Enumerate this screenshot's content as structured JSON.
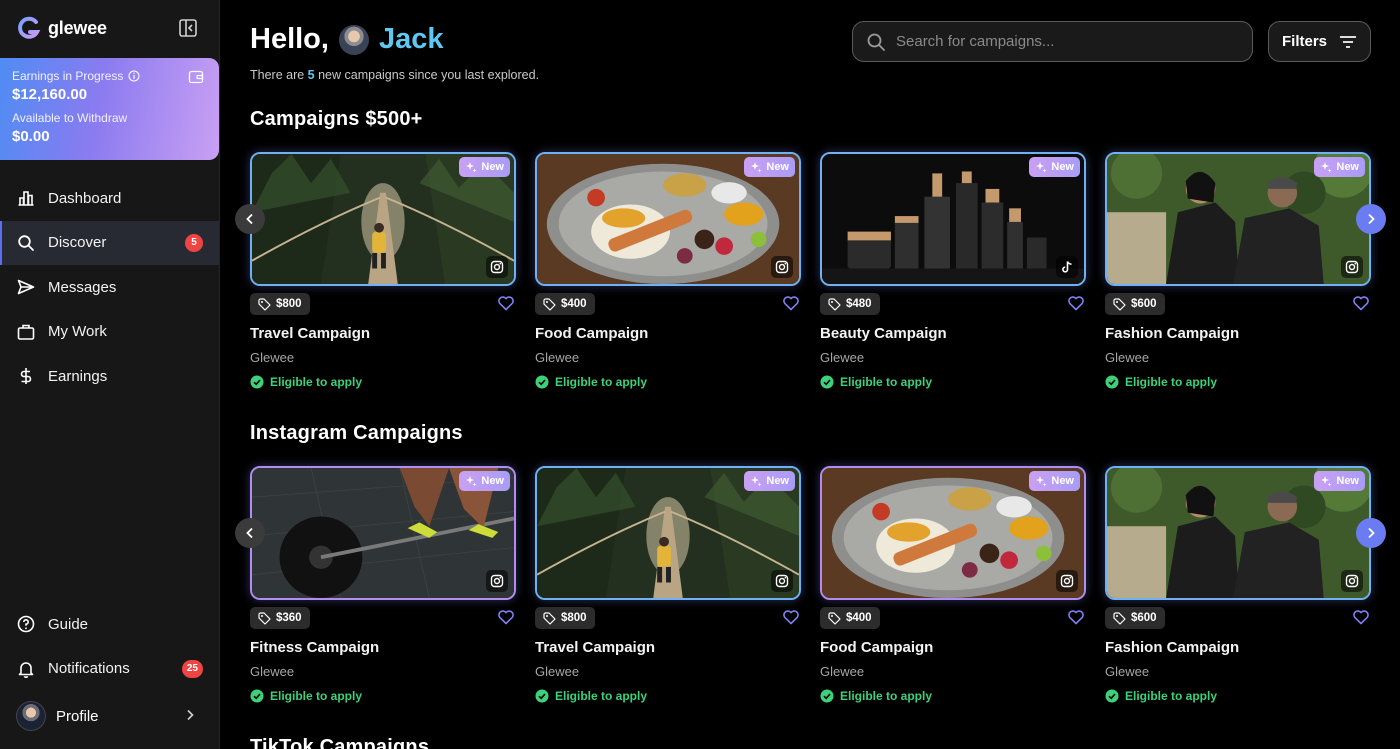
{
  "brand": {
    "name": "glewee"
  },
  "earnings_card": {
    "in_progress_label": "Earnings in Progress",
    "in_progress_value": "$12,160.00",
    "withdraw_label": "Available to Withdraw",
    "withdraw_value": "$0.00"
  },
  "nav": {
    "items": [
      {
        "label": "Dashboard",
        "icon": "bar-chart-icon"
      },
      {
        "label": "Discover",
        "icon": "search-icon",
        "badge": "5",
        "active": true
      },
      {
        "label": "Messages",
        "icon": "send-icon"
      },
      {
        "label": "My Work",
        "icon": "briefcase-icon"
      },
      {
        "label": "Earnings",
        "icon": "dollar-icon"
      }
    ],
    "bottom": [
      {
        "label": "Guide",
        "icon": "help-circle-icon"
      },
      {
        "label": "Notifications",
        "icon": "bell-icon",
        "badge": "25"
      }
    ],
    "profile_label": "Profile"
  },
  "header": {
    "greeting": "Hello,",
    "user_name": "Jack",
    "subtitle_pre": "There are ",
    "subtitle_count": "5",
    "subtitle_post": " new campaigns since you last explored.",
    "search_placeholder": "Search for campaigns...",
    "filters_label": "Filters"
  },
  "sections": [
    {
      "title": "Campaigns $500+",
      "cards": [
        {
          "price": "$800",
          "title": "Travel Campaign",
          "brand": "Glewee",
          "status": "Eligible to apply",
          "badge": "New",
          "platform": "instagram",
          "image": "bridge"
        },
        {
          "price": "$400",
          "title": "Food Campaign",
          "brand": "Glewee",
          "status": "Eligible to apply",
          "badge": "New",
          "platform": "instagram",
          "image": "food"
        },
        {
          "price": "$480",
          "title": "Beauty Campaign",
          "brand": "Glewee",
          "status": "Eligible to apply",
          "badge": "New",
          "platform": "tiktok",
          "image": "beauty"
        },
        {
          "price": "$600",
          "title": "Fashion Campaign",
          "brand": "Glewee",
          "status": "Eligible to apply",
          "badge": "New",
          "platform": "instagram",
          "image": "fashion"
        }
      ]
    },
    {
      "title": "Instagram Campaigns",
      "cards": [
        {
          "price": "$360",
          "title": "Fitness Campaign",
          "brand": "Glewee",
          "status": "Eligible to apply",
          "badge": "New",
          "platform": "instagram",
          "image": "fitness"
        },
        {
          "price": "$800",
          "title": "Travel Campaign",
          "brand": "Glewee",
          "status": "Eligible to apply",
          "badge": "New",
          "platform": "instagram",
          "image": "bridge"
        },
        {
          "price": "$400",
          "title": "Food Campaign",
          "brand": "Glewee",
          "status": "Eligible to apply",
          "badge": "New",
          "platform": "instagram",
          "image": "food"
        },
        {
          "price": "$600",
          "title": "Fashion Campaign",
          "brand": "Glewee",
          "status": "Eligible to apply",
          "badge": "New",
          "platform": "instagram",
          "image": "fashion"
        }
      ]
    },
    {
      "title": "TikTok Campaigns"
    }
  ],
  "colors": {
    "accent": "#5fc8f2",
    "badge_red": "#ef4444",
    "eligible_green": "#3dd17a",
    "arrow_blue": "#6b7cf3"
  }
}
